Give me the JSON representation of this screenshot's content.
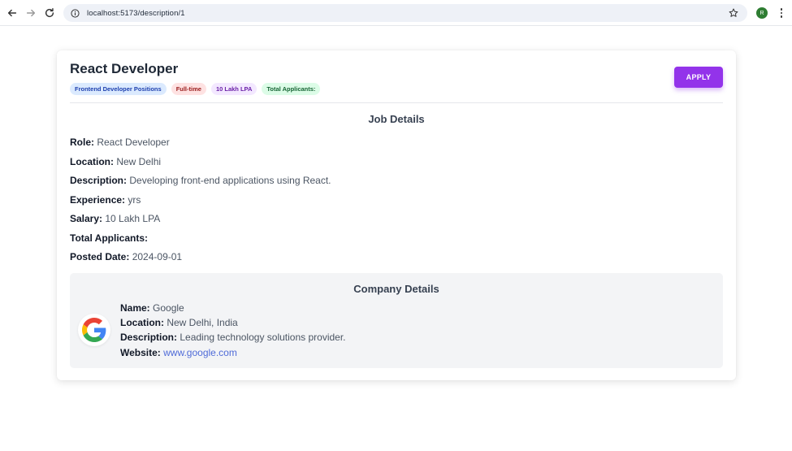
{
  "browser": {
    "url": "localhost:5173/description/1",
    "profile_initial": "R"
  },
  "job": {
    "title": "React Developer",
    "tags": {
      "position": "Frontend Developer Positions",
      "type": "Full-time",
      "salary": "10 Lakh LPA",
      "applicants": "Total Applicants:"
    },
    "apply_label": "APPLY"
  },
  "job_details": {
    "heading": "Job Details",
    "role_label": "Role:",
    "role": "React Developer",
    "location_label": "Location:",
    "location": "New Delhi",
    "description_label": "Description:",
    "description": "Developing front-end applications using React.",
    "experience_label": "Experience:",
    "experience": "yrs",
    "salary_label": "Salary:",
    "salary": "10 Lakh LPA",
    "applicants_label": "Total Applicants:",
    "applicants": "",
    "posted_label": "Posted Date:",
    "posted": "2024-09-01"
  },
  "company": {
    "heading": "Company Details",
    "name_label": "Name:",
    "name": "Google",
    "location_label": "Location:",
    "location": "New Delhi, India",
    "description_label": "Description:",
    "description": "Leading technology solutions provider.",
    "website_label": "Website:",
    "website": "www.google.com",
    "logo_icon": "google-logo"
  },
  "colors": {
    "apply_button": "#9333ea",
    "link": "#4f6bd8"
  }
}
